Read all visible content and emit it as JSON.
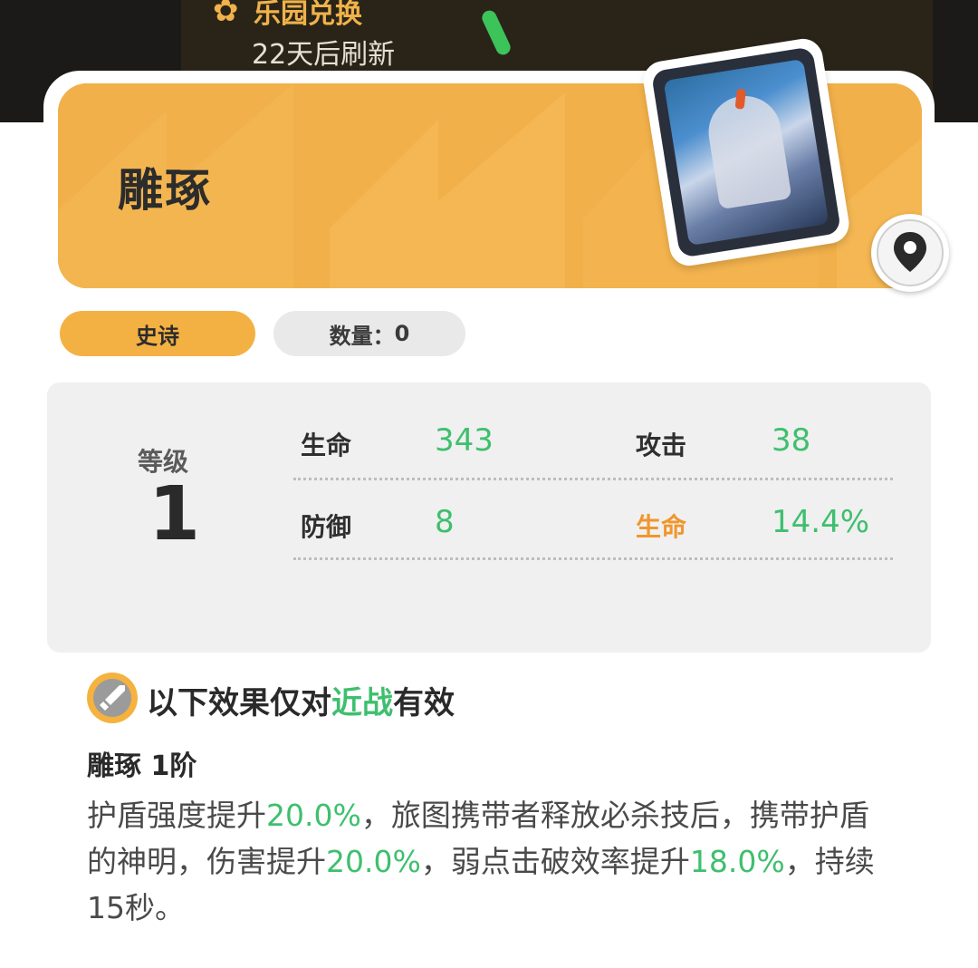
{
  "background": {
    "title": "乐园兑换",
    "refresh_text": "22天后刷新"
  },
  "item": {
    "name": "雕琢",
    "rarity": "史诗",
    "count_label": "数量：",
    "count_value": "0"
  },
  "stats": {
    "level_label": "等级",
    "level_value": "1",
    "rows": [
      {
        "label": "生命",
        "value": "343"
      },
      {
        "label": "攻击",
        "value": "38"
      },
      {
        "label": "防御",
        "value": "8"
      },
      {
        "label": "生命",
        "value": "14.4%"
      }
    ]
  },
  "effect": {
    "scope_prefix": "以下效果仅对",
    "scope_highlight": "近战",
    "scope_suffix": "有效",
    "tier_title": "雕琢 1阶",
    "desc_parts": [
      "护盾强度提升",
      "20.0%",
      "，旅图携带者释放必杀技后，携带护盾的神明，伤害提升",
      "20.0%",
      "，弱点击破效率提升",
      "18.0%",
      "，持续15秒。"
    ]
  },
  "icons": {
    "location": "map-pin-icon",
    "melee": "sword-icon",
    "background": "flower-icon"
  },
  "colors": {
    "banner": "#f2b04a",
    "accent_green": "#3fbf6e",
    "accent_orange": "#f0962c",
    "rarity_tag": "#f4b143"
  }
}
